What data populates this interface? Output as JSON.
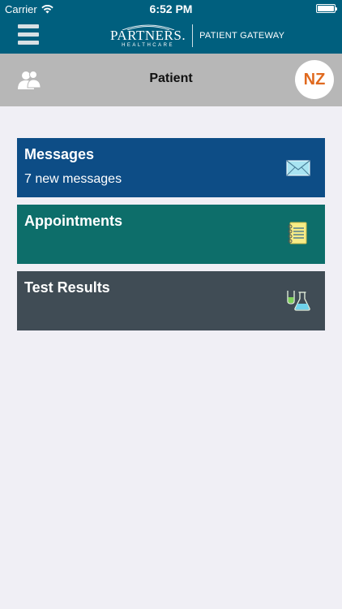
{
  "statusbar": {
    "carrier": "Carrier",
    "time": "6:52 PM"
  },
  "navbar": {
    "logo_main": "PARTNERS.",
    "logo_sub": "HEALTHCARE",
    "app_name": "PATIENT GATEWAY"
  },
  "subheader": {
    "title": "Patient",
    "avatar_initials": "NZ"
  },
  "tiles": [
    {
      "title": "Messages",
      "subtitle": "7 new messages",
      "icon": "envelope-icon",
      "color": "#0d4d86"
    },
    {
      "title": "Appointments",
      "subtitle": "",
      "icon": "notepad-icon",
      "color": "#0d6e6a"
    },
    {
      "title": "Test Results",
      "subtitle": "",
      "icon": "lab-beakers-icon",
      "color": "#404c55"
    }
  ],
  "colors": {
    "brand": "#005f7e",
    "avatar_text": "#e06a1f",
    "subheader": "#b7b7b7",
    "background": "#f0eff5"
  }
}
